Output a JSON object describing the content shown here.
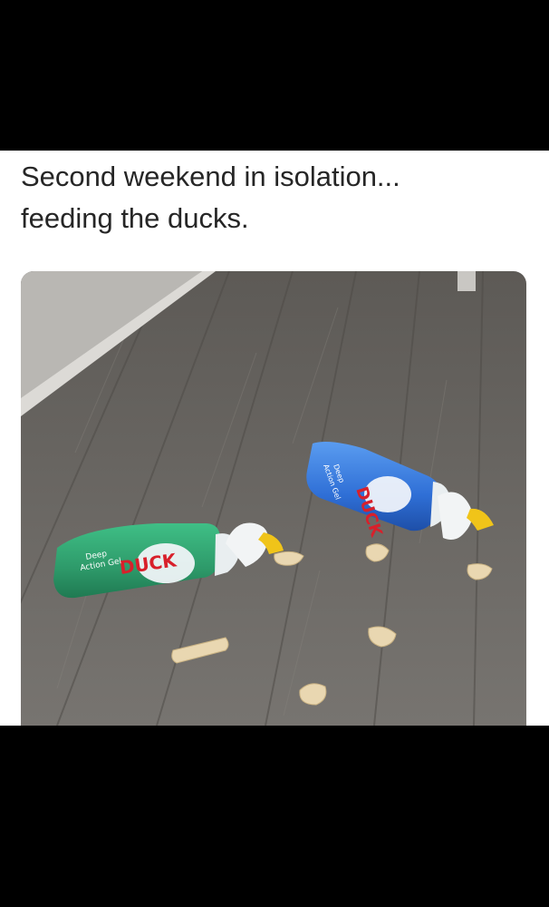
{
  "caption": {
    "line1": "Second weekend in isolation...",
    "line2": "feeding the ducks."
  },
  "photo": {
    "subject": "two toilet-cleaner bottles lying on a wood floor beside scattered bread pieces",
    "bottle_left": {
      "brand": "DUCK",
      "product_line1": "Deep",
      "product_line2": "Action Gel",
      "label_color": "#2e9a6a",
      "cap_color": "#f0c419"
    },
    "bottle_right": {
      "brand": "DUCK",
      "product_line1": "Deep",
      "product_line2": "Action Gel",
      "label_color": "#2f6fd6",
      "cap_color": "#f0c419"
    },
    "floor_color": "#6b6863",
    "bread_color": "#e9d7b1"
  }
}
